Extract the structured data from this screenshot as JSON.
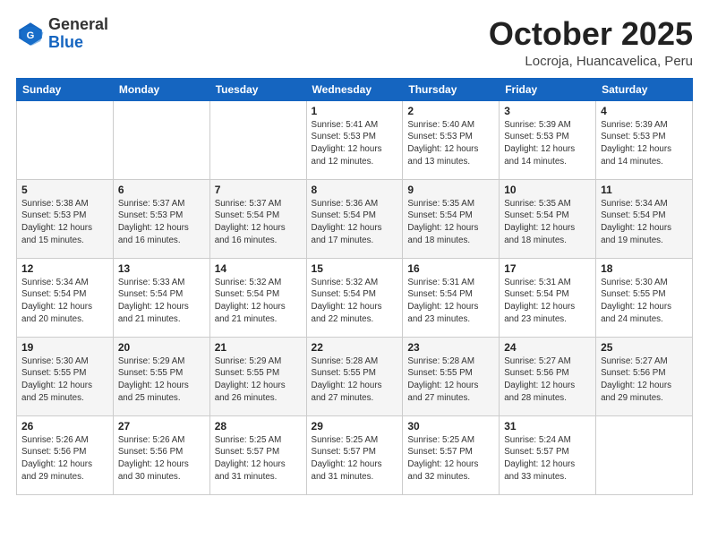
{
  "header": {
    "logo_general": "General",
    "logo_blue": "Blue",
    "month_title": "October 2025",
    "location": "Locroja, Huancavelica, Peru"
  },
  "weekdays": [
    "Sunday",
    "Monday",
    "Tuesday",
    "Wednesday",
    "Thursday",
    "Friday",
    "Saturday"
  ],
  "weeks": [
    [
      {
        "day": "",
        "info": ""
      },
      {
        "day": "",
        "info": ""
      },
      {
        "day": "",
        "info": ""
      },
      {
        "day": "1",
        "info": "Sunrise: 5:41 AM\nSunset: 5:53 PM\nDaylight: 12 hours\nand 12 minutes."
      },
      {
        "day": "2",
        "info": "Sunrise: 5:40 AM\nSunset: 5:53 PM\nDaylight: 12 hours\nand 13 minutes."
      },
      {
        "day": "3",
        "info": "Sunrise: 5:39 AM\nSunset: 5:53 PM\nDaylight: 12 hours\nand 14 minutes."
      },
      {
        "day": "4",
        "info": "Sunrise: 5:39 AM\nSunset: 5:53 PM\nDaylight: 12 hours\nand 14 minutes."
      }
    ],
    [
      {
        "day": "5",
        "info": "Sunrise: 5:38 AM\nSunset: 5:53 PM\nDaylight: 12 hours\nand 15 minutes."
      },
      {
        "day": "6",
        "info": "Sunrise: 5:37 AM\nSunset: 5:53 PM\nDaylight: 12 hours\nand 16 minutes."
      },
      {
        "day": "7",
        "info": "Sunrise: 5:37 AM\nSunset: 5:54 PM\nDaylight: 12 hours\nand 16 minutes."
      },
      {
        "day": "8",
        "info": "Sunrise: 5:36 AM\nSunset: 5:54 PM\nDaylight: 12 hours\nand 17 minutes."
      },
      {
        "day": "9",
        "info": "Sunrise: 5:35 AM\nSunset: 5:54 PM\nDaylight: 12 hours\nand 18 minutes."
      },
      {
        "day": "10",
        "info": "Sunrise: 5:35 AM\nSunset: 5:54 PM\nDaylight: 12 hours\nand 18 minutes."
      },
      {
        "day": "11",
        "info": "Sunrise: 5:34 AM\nSunset: 5:54 PM\nDaylight: 12 hours\nand 19 minutes."
      }
    ],
    [
      {
        "day": "12",
        "info": "Sunrise: 5:34 AM\nSunset: 5:54 PM\nDaylight: 12 hours\nand 20 minutes."
      },
      {
        "day": "13",
        "info": "Sunrise: 5:33 AM\nSunset: 5:54 PM\nDaylight: 12 hours\nand 21 minutes."
      },
      {
        "day": "14",
        "info": "Sunrise: 5:32 AM\nSunset: 5:54 PM\nDaylight: 12 hours\nand 21 minutes."
      },
      {
        "day": "15",
        "info": "Sunrise: 5:32 AM\nSunset: 5:54 PM\nDaylight: 12 hours\nand 22 minutes."
      },
      {
        "day": "16",
        "info": "Sunrise: 5:31 AM\nSunset: 5:54 PM\nDaylight: 12 hours\nand 23 minutes."
      },
      {
        "day": "17",
        "info": "Sunrise: 5:31 AM\nSunset: 5:54 PM\nDaylight: 12 hours\nand 23 minutes."
      },
      {
        "day": "18",
        "info": "Sunrise: 5:30 AM\nSunset: 5:55 PM\nDaylight: 12 hours\nand 24 minutes."
      }
    ],
    [
      {
        "day": "19",
        "info": "Sunrise: 5:30 AM\nSunset: 5:55 PM\nDaylight: 12 hours\nand 25 minutes."
      },
      {
        "day": "20",
        "info": "Sunrise: 5:29 AM\nSunset: 5:55 PM\nDaylight: 12 hours\nand 25 minutes."
      },
      {
        "day": "21",
        "info": "Sunrise: 5:29 AM\nSunset: 5:55 PM\nDaylight: 12 hours\nand 26 minutes."
      },
      {
        "day": "22",
        "info": "Sunrise: 5:28 AM\nSunset: 5:55 PM\nDaylight: 12 hours\nand 27 minutes."
      },
      {
        "day": "23",
        "info": "Sunrise: 5:28 AM\nSunset: 5:55 PM\nDaylight: 12 hours\nand 27 minutes."
      },
      {
        "day": "24",
        "info": "Sunrise: 5:27 AM\nSunset: 5:56 PM\nDaylight: 12 hours\nand 28 minutes."
      },
      {
        "day": "25",
        "info": "Sunrise: 5:27 AM\nSunset: 5:56 PM\nDaylight: 12 hours\nand 29 minutes."
      }
    ],
    [
      {
        "day": "26",
        "info": "Sunrise: 5:26 AM\nSunset: 5:56 PM\nDaylight: 12 hours\nand 29 minutes."
      },
      {
        "day": "27",
        "info": "Sunrise: 5:26 AM\nSunset: 5:56 PM\nDaylight: 12 hours\nand 30 minutes."
      },
      {
        "day": "28",
        "info": "Sunrise: 5:25 AM\nSunset: 5:57 PM\nDaylight: 12 hours\nand 31 minutes."
      },
      {
        "day": "29",
        "info": "Sunrise: 5:25 AM\nSunset: 5:57 PM\nDaylight: 12 hours\nand 31 minutes."
      },
      {
        "day": "30",
        "info": "Sunrise: 5:25 AM\nSunset: 5:57 PM\nDaylight: 12 hours\nand 32 minutes."
      },
      {
        "day": "31",
        "info": "Sunrise: 5:24 AM\nSunset: 5:57 PM\nDaylight: 12 hours\nand 33 minutes."
      },
      {
        "day": "",
        "info": ""
      }
    ]
  ]
}
